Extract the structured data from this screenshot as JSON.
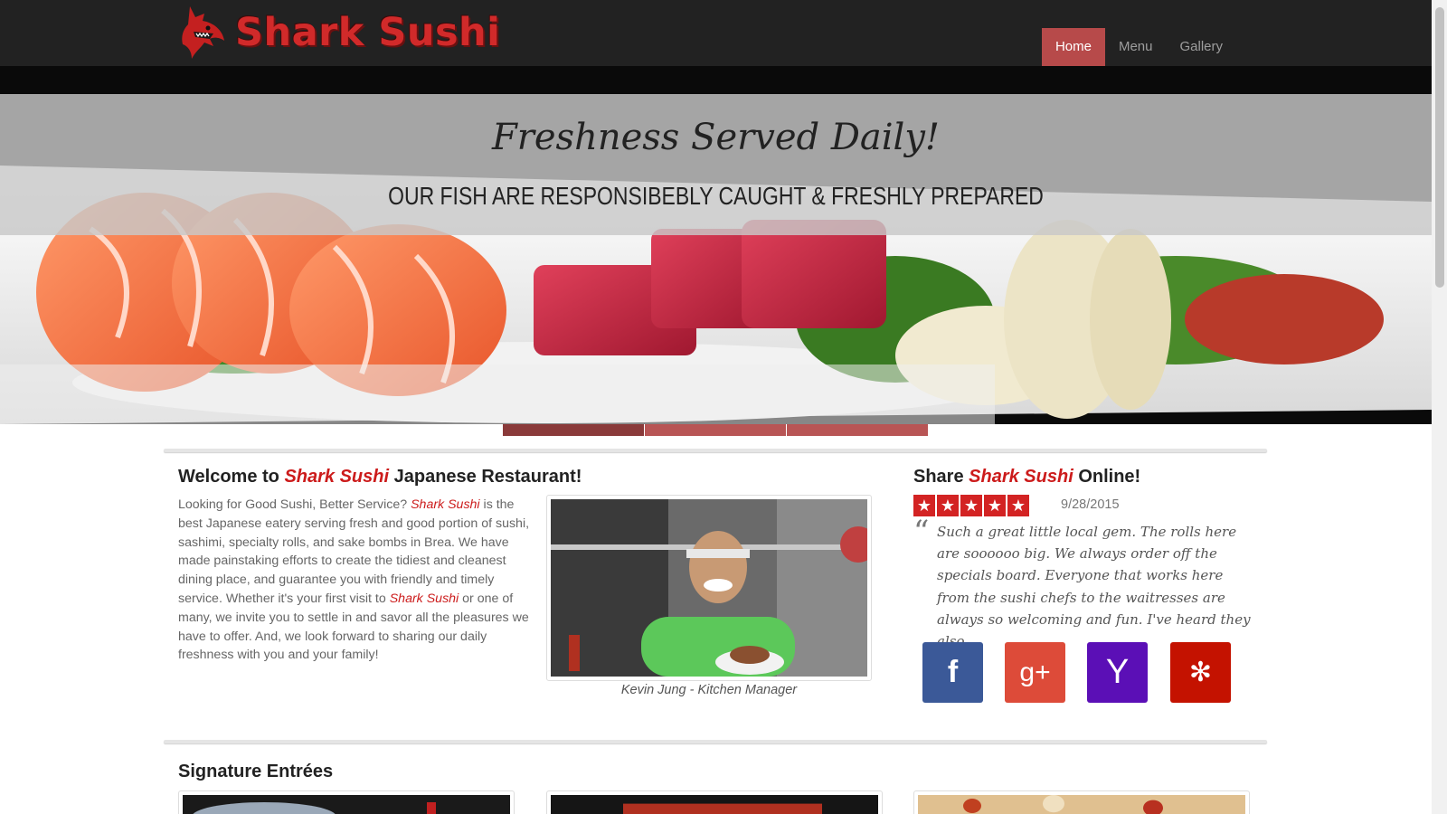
{
  "brand": {
    "name": "Shark Sushi",
    "logo_icon": "shark-logo-icon",
    "color": "#d12a2a"
  },
  "nav": {
    "items": [
      {
        "label": "Home",
        "active": true
      },
      {
        "label": "Menu",
        "active": false
      },
      {
        "label": "Gallery",
        "active": false
      }
    ]
  },
  "hero": {
    "title": "Freshness Served Daily!",
    "subtitle": "OUR FISH ARE RESPONSIBEBLY CAUGHT & FRESHLY PREPARED",
    "indicators": 3,
    "active_indicator": 1
  },
  "welcome": {
    "title_prefix": "Welcome to ",
    "title_brand": "Shark Sushi",
    "title_suffix": " Japanese Restaurant!",
    "body_part1": "Looking for Good Sushi, Better Service? ",
    "body_brand1": "Shark Sushi",
    "body_part2": " is the best Japanese eatery serving fresh and good portion of sushi, sashimi, specialty rolls, and sake bombs in Brea. We have made painstaking efforts to create the tidiest and cleanest dining place, and guarantee you with friendly and timely service. Whether it's your first visit to ",
    "body_brand2": "Shark Sushi",
    "body_part3": " or one of many, we invite you to settle in and savor all the pleasures we have to offer. And, we look forward to sharing our daily freshness with you and your family!",
    "photo_caption": "Kevin Jung - Kitchen Manager"
  },
  "share": {
    "title_prefix": "Share ",
    "title_brand": "Shark Sushi",
    "title_suffix": " Online!",
    "rating": 5,
    "review_date": "9/28/2015",
    "review_text": "Such a great little local gem. The rolls here are soooooo big. We always order off the specials board. Everyone that works here from the sushi chefs to the waitresses are always so welcoming and fun. I've heard they also ...",
    "social": [
      {
        "name": "facebook",
        "glyph": "f",
        "color": "#3b5998"
      },
      {
        "name": "google-plus",
        "glyph": "g+",
        "color": "#dd4b39"
      },
      {
        "name": "yahoo",
        "glyph": "Y",
        "color": "#5b0fb6"
      },
      {
        "name": "yelp",
        "glyph": "✻",
        "color": "#c41200"
      }
    ]
  },
  "signature": {
    "title": "Signature Entrées"
  }
}
